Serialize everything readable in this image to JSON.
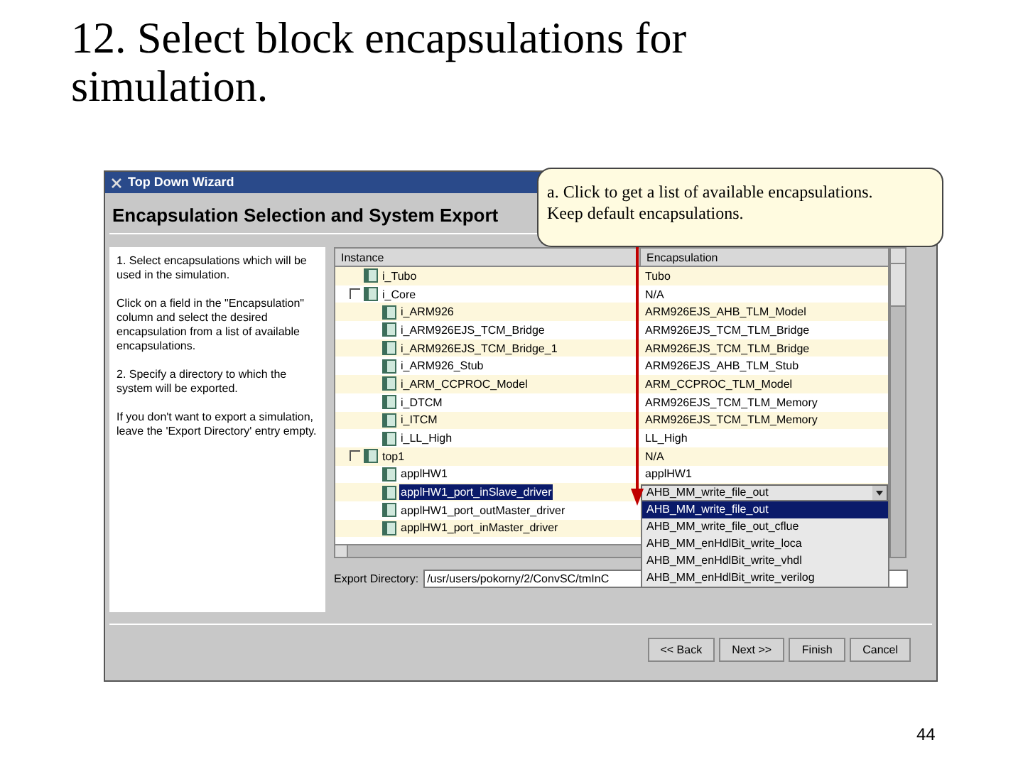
{
  "slide": {
    "title": "12. Select block encapsulations for simulation.",
    "page_number": "44"
  },
  "window": {
    "title": "Top Down Wizard",
    "heading": "Encapsulation Selection and System Export"
  },
  "instructions": [
    "1. Select encapsulations which will be used in the simulation.",
    "Click on a field in the \"Encapsulation\" column and select the desired encapsulation from a list of available encapsulations.",
    "2. Specify a directory to which the system will be exported.",
    "If you don't want to export a simulation, leave the 'Export Directory' entry empty."
  ],
  "table": {
    "columns": [
      "Instance",
      "Encapsulation"
    ],
    "rows": [
      {
        "instance": "i_Tubo",
        "encapsulation": "Tubo",
        "selected": false
      },
      {
        "instance": "i_Core",
        "encapsulation": "N/A",
        "selected": false,
        "expanded": true,
        "children": [
          {
            "instance": "i_ARM926",
            "encapsulation": "ARM926EJS_AHB_TLM_Model",
            "selected": false
          },
          {
            "instance": "i_ARM926EJS_TCM_Bridge",
            "encapsulation": "ARM926EJS_TCM_TLM_Bridge",
            "selected": false
          },
          {
            "instance": "i_ARM926EJS_TCM_Bridge_1",
            "encapsulation": "ARM926EJS_TCM_TLM_Bridge",
            "selected": false
          },
          {
            "instance": "i_ARM926_Stub",
            "encapsulation": "ARM926EJS_AHB_TLM_Stub",
            "selected": false
          },
          {
            "instance": "i_ARM_CCPROC_Model",
            "encapsulation": "ARM_CCPROC_TLM_Model",
            "selected": false
          },
          {
            "instance": "i_DTCM",
            "encapsulation": "ARM926EJS_TCM_TLM_Memory",
            "selected": false
          },
          {
            "instance": "i_ITCM",
            "encapsulation": "ARM926EJS_TCM_TLM_Memory",
            "selected": false
          },
          {
            "instance": "i_LL_High",
            "encapsulation": "LL_High",
            "selected": false
          }
        ]
      },
      {
        "instance": "top1",
        "encapsulation": "N/A",
        "selected": false,
        "expanded": true,
        "children": [
          {
            "instance": "applHW1",
            "encapsulation": "applHW1",
            "selected": false
          },
          {
            "instance": "applHW1_port_inSlave_driver",
            "encapsulation": "AHB_MM_write_file_out",
            "selected": true
          },
          {
            "instance": "applHW1_port_outMaster_driver",
            "selected": false
          },
          {
            "instance": "applHW1_port_inMaster_driver",
            "selected": false
          }
        ]
      }
    ]
  },
  "dropdown": {
    "options": [
      {
        "label": "AHB_MM_write_file_out",
        "selected": true
      },
      {
        "label": "AHB_MM_write_file_out_cflue",
        "selected": false
      },
      {
        "label": "AHB_MM_enHdlBit_write_loca",
        "selected": false
      },
      {
        "label": "AHB_MM_enHdlBit_write_vhdl",
        "selected": false
      },
      {
        "label": "AHB_MM_enHdlBit_write_verilog",
        "selected": false
      }
    ]
  },
  "export_directory": {
    "label": "Export Directory:",
    "value": "/usr/users/pokorny/2/ConvSC/tmInC"
  },
  "buttons": [
    "<< Back",
    "Next >>",
    "Finish",
    "Cancel"
  ],
  "callout": {
    "lines": [
      "a. Click to get a list of available encapsulations.",
      "Keep default encapsulations."
    ]
  }
}
